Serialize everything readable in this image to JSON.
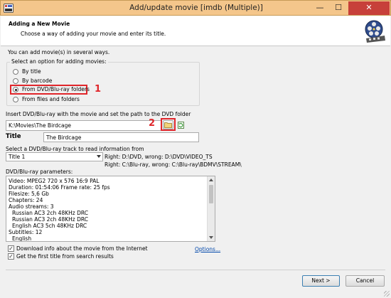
{
  "window": {
    "title": "Add/update movie [imdb (Multiple)]",
    "controls": {
      "minimize": "—",
      "maximize": "☐",
      "close": "✕"
    }
  },
  "header": {
    "title": "Adding a New Movie",
    "subtitle": "Choose a way of adding your movie and enter its title."
  },
  "intro": "You can add movie(s) in several ways.",
  "options_group": {
    "title": "Select an option for adding movies:",
    "options": [
      {
        "label": "By title",
        "selected": false
      },
      {
        "label": "By barcode",
        "selected": false
      },
      {
        "label": "From DVD/Blu-ray folders",
        "selected": true
      },
      {
        "label": "From files and folders",
        "selected": false
      }
    ]
  },
  "markers": {
    "one": "1",
    "two": "2"
  },
  "path": {
    "label": "Insert DVD/Blu-ray with the movie and set the path to the DVD folder",
    "value": "K:\\Movies\\The Birdcage"
  },
  "title_field": {
    "label": "Title",
    "value": "The Birdcage"
  },
  "track": {
    "label": "Select a DVD/Blu-ray track to read information from",
    "value": "Title 1",
    "hint_dvd": "Right: D:\\DVD, wrong: D:\\DVD\\VIDEO_TS",
    "hint_bluray": "Right: C:\\Blu-ray, wrong: C:\\Blu-ray\\BDMV\\STREAM\\"
  },
  "params": {
    "label": "DVD/Blu-ray parameters:",
    "lines": [
      "Video: MPEG2 720 x 576 16:9 PAL",
      "Duration: 01:54:06 Frame rate: 25 fps",
      "Filesize: 5,6 Gb",
      "Chapters: 24",
      "Audio streams: 3",
      "  Russian AC3 2ch 48KHz DRC",
      "  Russian AC3 2ch 48KHz DRC",
      "  English AC3 5ch 48KHz DRC",
      "Subtitles: 12",
      "  English"
    ]
  },
  "checks": {
    "download": {
      "label": "Download info about the movie from the Internet",
      "checked": true
    },
    "first_title": {
      "label": "Get the first title from search results",
      "checked": true
    },
    "options_link": "Options..."
  },
  "buttons": {
    "next": "Next >",
    "cancel": "Cancel"
  },
  "colors": {
    "accent_red": "#e0262b",
    "titlebar": "#f4c68b",
    "close": "#c7403a",
    "link": "#0047ab"
  }
}
